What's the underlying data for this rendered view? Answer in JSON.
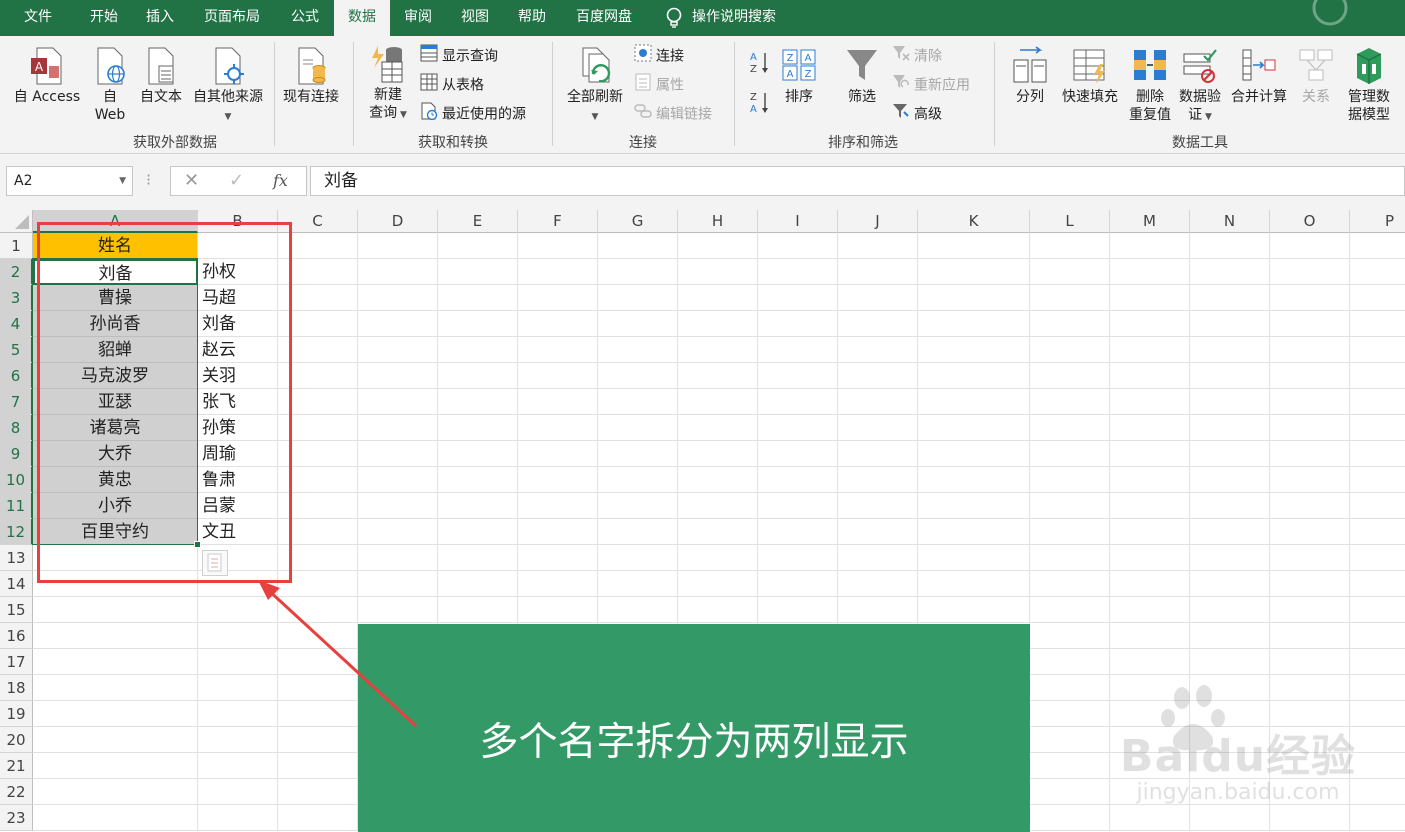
{
  "menu": {
    "tabs": [
      "文件",
      "开始",
      "插入",
      "页面布局",
      "公式",
      "数据",
      "审阅",
      "视图",
      "帮助",
      "百度网盘"
    ],
    "active_tab": "数据",
    "tell_me": "操作说明搜索"
  },
  "ribbon": {
    "get_external": {
      "access_label": "自 Access",
      "web_label_1": "自",
      "web_label_2": "Web",
      "text_label": "自文本",
      "other_label": "自其他来源",
      "existing_label": "现有连接",
      "group_label": "获取外部数据"
    },
    "get_transform": {
      "new_query_1": "新建",
      "new_query_2": "查询",
      "show_queries": "显示查询",
      "from_table": "从表格",
      "recent_sources": "最近使用的源",
      "group_label": "获取和转换"
    },
    "connections": {
      "refresh_all": "全部刷新",
      "connections": "连接",
      "properties": "属性",
      "edit_links": "编辑链接",
      "group_label": "连接"
    },
    "sort_filter": {
      "sort": "排序",
      "filter": "筛选",
      "clear": "清除",
      "reapply": "重新应用",
      "advanced": "高级",
      "group_label": "排序和筛选"
    },
    "data_tools": {
      "text_to_columns": "分列",
      "flash_fill": "快速填充",
      "remove_dup_1": "删除",
      "remove_dup_2": "重复值",
      "validation_1": "数据验",
      "validation_2": "证",
      "consolidate": "合并计算",
      "relationships": "关系",
      "manage_model_1": "管理数",
      "manage_model_2": "据模型",
      "group_label": "数据工具"
    }
  },
  "formula_bar": {
    "name_box": "A2",
    "cancel_symbol": "✕",
    "enter_symbol": "✓",
    "fx_symbol": "fx",
    "formula": "刘备"
  },
  "sheet": {
    "columns": [
      "A",
      "B",
      "C",
      "D",
      "E",
      "F",
      "G",
      "H",
      "I",
      "J",
      "K",
      "L",
      "M",
      "N",
      "O",
      "P"
    ],
    "rows": [
      "1",
      "2",
      "3",
      "4",
      "5",
      "6",
      "7",
      "8",
      "9",
      "10",
      "11",
      "12",
      "13",
      "14",
      "15",
      "16",
      "17",
      "18",
      "19",
      "20",
      "21",
      "22",
      "23"
    ],
    "header_a1": "姓名",
    "col_a": [
      "刘备",
      "曹操",
      "孙尚香",
      "貂蝉",
      "马克波罗",
      "亚瑟",
      "诸葛亮",
      "大乔",
      "黄忠",
      "小乔",
      "百里守约"
    ],
    "col_b": [
      "孙权",
      "马超",
      "刘备",
      "赵云",
      "关羽",
      "张飞",
      "孙策",
      "周瑜",
      "鲁肃",
      "吕蒙",
      "文丑"
    ]
  },
  "banner_text": "多个名字拆分为两列显示",
  "watermark": {
    "logo": "Baidu经验",
    "url": "jingyan.baidu.com"
  },
  "colors": {
    "excel_green": "#217346",
    "header_fill": "#ffc000",
    "selection_fill": "#d0d0d0",
    "banner_fill": "#339966",
    "annotation_red": "#e8403e"
  }
}
